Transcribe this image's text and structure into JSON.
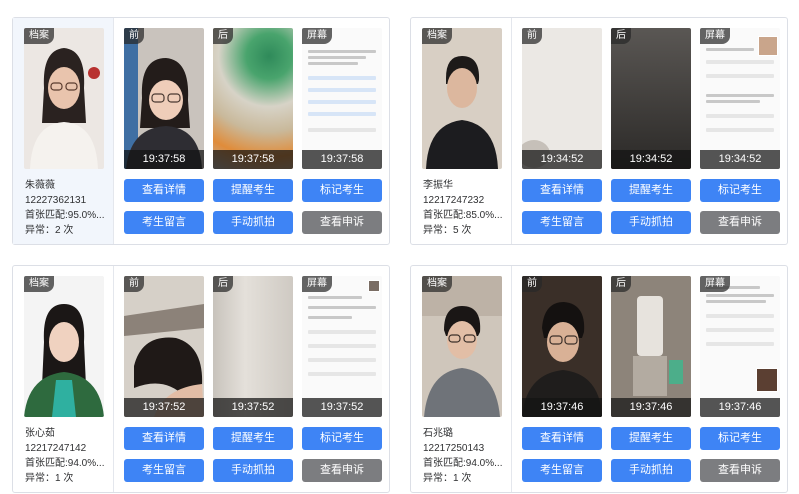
{
  "labels": {
    "profile_tag": "档案",
    "front_tag": "前",
    "back_tag": "后",
    "screen_tag": "屏幕"
  },
  "buttons": {
    "details": "查看详情",
    "remind": "提醒考生",
    "mark": "标记考生",
    "message": "考生留言",
    "capture": "手动抓拍",
    "appeal": "查看申诉"
  },
  "colors": {
    "primary_button": "#3e84f5",
    "secondary_button": "#7c7d80",
    "selected_card_bg": "#f2f6fc"
  },
  "candidates": [
    {
      "name": "朱薇薇",
      "id": "12227362131",
      "match": "首张匹配:95.0%...",
      "abnormal": "异常：2 次",
      "time_front": "19:37:58",
      "time_back": "19:37:58",
      "time_screen": "19:37:58"
    },
    {
      "name": "李振华",
      "id": "12217247232",
      "match": "首张匹配:85.0%...",
      "abnormal": "异常：5 次",
      "time_front": "19:34:52",
      "time_back": "19:34:52",
      "time_screen": "19:34:52"
    },
    {
      "name": "张心茹",
      "id": "12217247142",
      "match": "首张匹配:94.0%...",
      "abnormal": "异常：1 次",
      "time_front": "19:37:52",
      "time_back": "19:37:52",
      "time_screen": "19:37:52"
    },
    {
      "name": "石兆璐",
      "id": "12217250143",
      "match": "首张匹配:94.0%...",
      "abnormal": "异常：1 次",
      "time_front": "19:37:46",
      "time_back": "19:37:46",
      "time_screen": "19:37:46"
    }
  ]
}
